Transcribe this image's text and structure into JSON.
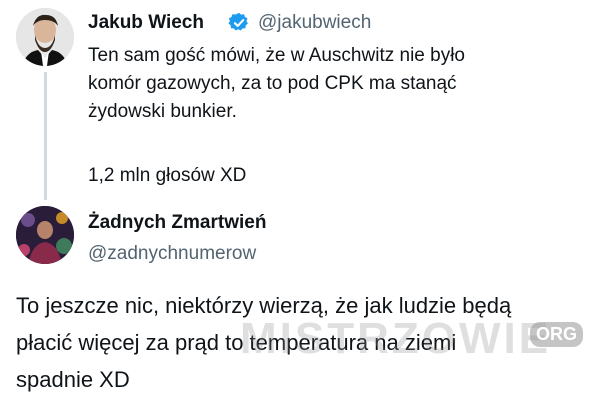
{
  "tweet1": {
    "name": "Jakub Wiech",
    "handle": "@jakubwiech",
    "lines": [
      "Ten sam gość mówi, że w Auschwitz nie było",
      "komór gazowych, za to pod CPK ma stanąć",
      "żydowski bunkier."
    ],
    "votes": "1,2 mln głosów XD",
    "verified_color": "#1d9bf0"
  },
  "tweet2": {
    "name": "Żadnych Zmartwień",
    "handle": "@zadnychnumerow",
    "lines": [
      "To jeszcze nic, niektórzy wierzą, że jak ludzie będą",
      "płacić więcej za prąd to temperatura na ziemi",
      "spadnie XD"
    ]
  },
  "watermark": {
    "text": "MISTRZOWIE",
    "org": "ORG"
  }
}
